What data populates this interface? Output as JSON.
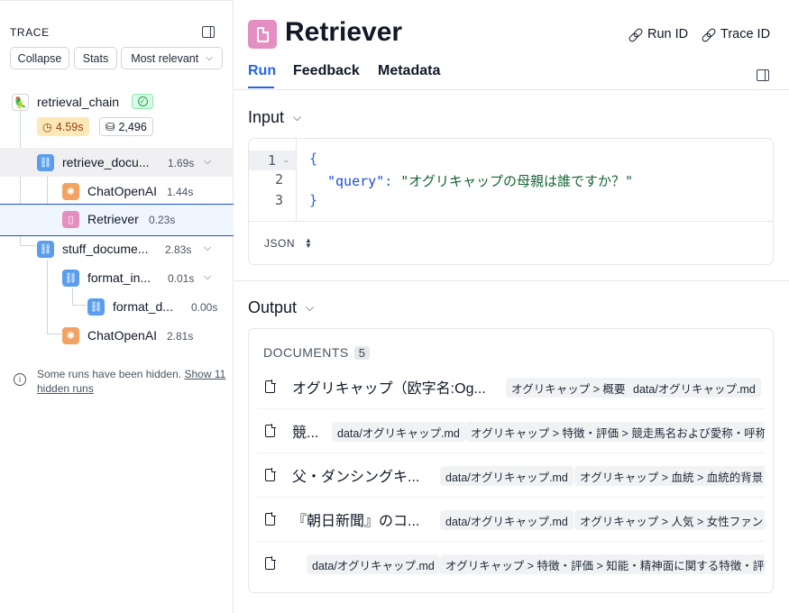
{
  "sidebar": {
    "title": "TRACE",
    "buttons": {
      "collapse": "Collapse",
      "stats": "Stats",
      "sort": "Most relevant"
    },
    "root": {
      "label": "retrieval_chain",
      "latency": "4.59s",
      "tokens": "2,496"
    },
    "runs": [
      {
        "label": "retrieve_docu...",
        "time": "1.69s",
        "type": "chain"
      },
      {
        "label": "ChatOpenAI",
        "time": "1.44s",
        "type": "llm"
      },
      {
        "label": "Retriever",
        "time": "0.23s",
        "type": "retriever"
      },
      {
        "label": "stuff_docume...",
        "time": "2.83s",
        "type": "chain"
      },
      {
        "label": "format_in...",
        "time": "0.01s",
        "type": "chain"
      },
      {
        "label": "format_d...",
        "time": "0.00s",
        "type": "chain"
      },
      {
        "label": "ChatOpenAI",
        "time": "2.81s",
        "type": "llm"
      }
    ],
    "hidden_note": "Some runs have been hidden.",
    "hidden_link": "Show 11 hidden runs"
  },
  "header": {
    "title": "Retriever",
    "run_id": "Run ID",
    "trace_id": "Trace ID"
  },
  "tabs": [
    "Run",
    "Feedback",
    "Metadata"
  ],
  "input": {
    "heading": "Input",
    "line_numbers": [
      "1",
      "2",
      "3"
    ],
    "lines": {
      "open": "{",
      "key": "\"query\"",
      "colon": ": ",
      "value": "\"オグリキャップの母親は誰ですか？\"",
      "close": "}"
    },
    "format": "JSON"
  },
  "output": {
    "heading": "Output",
    "documents_label": "DOCUMENTS",
    "documents_count": "5",
    "documents": [
      {
        "text": "オグリキャップ（欧字名:Og...",
        "tags": [
          "オグリキャップ > 概要",
          "data/オグリキャップ.md"
        ]
      },
      {
        "text": "競...",
        "tags": [
          "data/オグリキャップ.md",
          "オグリキャップ > 特徴・評価 > 競走馬名および愛称・呼称"
        ]
      },
      {
        "text": "父・ダンシングキ...",
        "tags": [
          "data/オグリキャップ.md",
          "オグリキャップ > 血統 > 血統的背景"
        ]
      },
      {
        "text": "『朝日新聞』のコ...",
        "tags": [
          "data/オグリキャップ.md",
          "オグリキャップ > 人気 > 女性ファン"
        ]
      },
      {
        "text": "",
        "tags": [
          "data/オグリキャップ.md",
          "オグリキャップ > 特徴・評価 > 知能・精神面に関する特徴・評価"
        ]
      }
    ]
  }
}
